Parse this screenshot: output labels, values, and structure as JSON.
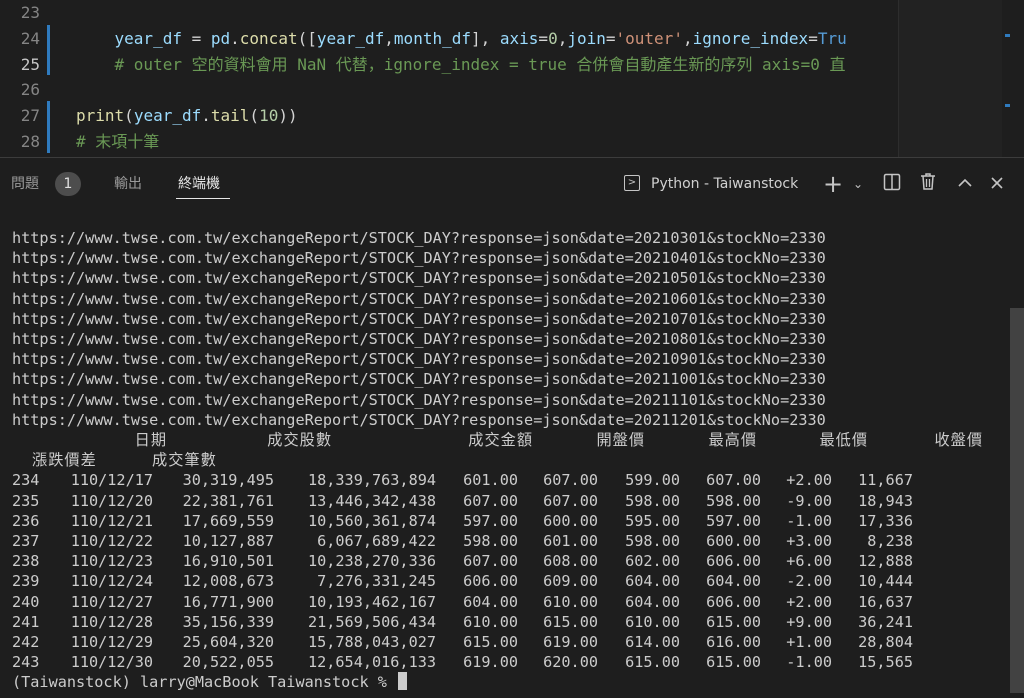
{
  "editor": {
    "lines": [
      {
        "num": "23",
        "active": false,
        "tokens": []
      },
      {
        "num": "24",
        "active": false,
        "tokens": [
          {
            "t": "    ",
            "c": "plain"
          },
          {
            "t": "year_df",
            "c": "var"
          },
          {
            "t": " = ",
            "c": "plain"
          },
          {
            "t": "pd",
            "c": "var"
          },
          {
            "t": ".",
            "c": "plain"
          },
          {
            "t": "concat",
            "c": "fn"
          },
          {
            "t": "([",
            "c": "plain"
          },
          {
            "t": "year_df",
            "c": "var"
          },
          {
            "t": ",",
            "c": "plain"
          },
          {
            "t": "month_df",
            "c": "var"
          },
          {
            "t": "], ",
            "c": "plain"
          },
          {
            "t": "axis",
            "c": "var"
          },
          {
            "t": "=",
            "c": "plain"
          },
          {
            "t": "0",
            "c": "num"
          },
          {
            "t": ",",
            "c": "plain"
          },
          {
            "t": "join",
            "c": "var"
          },
          {
            "t": "=",
            "c": "plain"
          },
          {
            "t": "'outer'",
            "c": "str"
          },
          {
            "t": ",",
            "c": "plain"
          },
          {
            "t": "ignore_index",
            "c": "var"
          },
          {
            "t": "=",
            "c": "plain"
          },
          {
            "t": "Tru",
            "c": "kw"
          }
        ]
      },
      {
        "num": "25",
        "active": true,
        "tokens": [
          {
            "t": "    ",
            "c": "plain"
          },
          {
            "t": "# outer 空的資料會用 NaN 代替，ignore_index = true 合併會自動產生新的序列 axis=0 直",
            "c": "comment"
          }
        ]
      },
      {
        "num": "26",
        "active": false,
        "tokens": []
      },
      {
        "num": "27",
        "active": false,
        "tokens": [
          {
            "t": "print",
            "c": "fn"
          },
          {
            "t": "(",
            "c": "plain"
          },
          {
            "t": "year_df",
            "c": "var"
          },
          {
            "t": ".",
            "c": "plain"
          },
          {
            "t": "tail",
            "c": "fn"
          },
          {
            "t": "(",
            "c": "plain"
          },
          {
            "t": "10",
            "c": "num"
          },
          {
            "t": "))",
            "c": "plain"
          }
        ]
      },
      {
        "num": "28",
        "active": false,
        "tokens": [
          {
            "t": "# 末項十筆",
            "c": "comment"
          }
        ]
      }
    ]
  },
  "panel": {
    "tabs": [
      {
        "label": "問題"
      },
      {
        "label": "輸出"
      },
      {
        "label": "終端機"
      }
    ],
    "problems_count": "1",
    "terminal_name": "Python - Taiwanstock",
    "icons": [
      "terminal-icon",
      "add-icon",
      "chevron-down-icon",
      "split-icon",
      "trash-icon",
      "chevron-up-icon",
      "close-icon"
    ]
  },
  "terminal": {
    "urls": [
      "https://www.twse.com.tw/exchangeReport/STOCK_DAY?response=json&date=20210301&stockNo=2330",
      "https://www.twse.com.tw/exchangeReport/STOCK_DAY?response=json&date=20210401&stockNo=2330",
      "https://www.twse.com.tw/exchangeReport/STOCK_DAY?response=json&date=20210501&stockNo=2330",
      "https://www.twse.com.tw/exchangeReport/STOCK_DAY?response=json&date=20210601&stockNo=2330",
      "https://www.twse.com.tw/exchangeReport/STOCK_DAY?response=json&date=20210701&stockNo=2330",
      "https://www.twse.com.tw/exchangeReport/STOCK_DAY?response=json&date=20210801&stockNo=2330",
      "https://www.twse.com.tw/exchangeReport/STOCK_DAY?response=json&date=20210901&stockNo=2330",
      "https://www.twse.com.tw/exchangeReport/STOCK_DAY?response=json&date=20211001&stockNo=2330",
      "https://www.twse.com.tw/exchangeReport/STOCK_DAY?response=json&date=20211101&stockNo=2330",
      "https://www.twse.com.tw/exchangeReport/STOCK_DAY?response=json&date=20211201&stockNo=2330"
    ],
    "headers": [
      "日期",
      "成交股數",
      "成交金額",
      "開盤價",
      "最高價",
      "最低價",
      "收盤價",
      "漲跌價差",
      "成交筆數"
    ],
    "rows": [
      [
        "234",
        "110/12/17",
        "30,319,495",
        "18,339,763,894",
        "601.00",
        "607.00",
        "599.00",
        "607.00",
        "+2.00",
        "11,667"
      ],
      [
        "235",
        "110/12/20",
        "22,381,761",
        "13,446,342,438",
        "607.00",
        "607.00",
        "598.00",
        "598.00",
        "-9.00",
        "18,943"
      ],
      [
        "236",
        "110/12/21",
        "17,669,559",
        "10,560,361,874",
        "597.00",
        "600.00",
        "595.00",
        "597.00",
        "-1.00",
        "17,336"
      ],
      [
        "237",
        "110/12/22",
        "10,127,887",
        "6,067,689,422",
        "598.00",
        "601.00",
        "598.00",
        "600.00",
        "+3.00",
        "8,238"
      ],
      [
        "238",
        "110/12/23",
        "16,910,501",
        "10,238,270,336",
        "607.00",
        "608.00",
        "602.00",
        "606.00",
        "+6.00",
        "12,888"
      ],
      [
        "239",
        "110/12/24",
        "12,008,673",
        "7,276,331,245",
        "606.00",
        "609.00",
        "604.00",
        "604.00",
        "-2.00",
        "10,444"
      ],
      [
        "240",
        "110/12/27",
        "16,771,900",
        "10,193,462,167",
        "604.00",
        "610.00",
        "604.00",
        "606.00",
        "+2.00",
        "16,637"
      ],
      [
        "241",
        "110/12/28",
        "35,156,339",
        "21,569,506,434",
        "610.00",
        "615.00",
        "610.00",
        "615.00",
        "+9.00",
        "36,241"
      ],
      [
        "242",
        "110/12/29",
        "25,604,320",
        "15,788,043,027",
        "615.00",
        "619.00",
        "614.00",
        "616.00",
        "+1.00",
        "28,804"
      ],
      [
        "243",
        "110/12/30",
        "20,522,055",
        "12,654,016,133",
        "619.00",
        "620.00",
        "615.00",
        "615.00",
        "-1.00",
        "15,565"
      ]
    ],
    "prompt": "(Taiwanstock) larry@MacBook Taiwanstock % "
  }
}
